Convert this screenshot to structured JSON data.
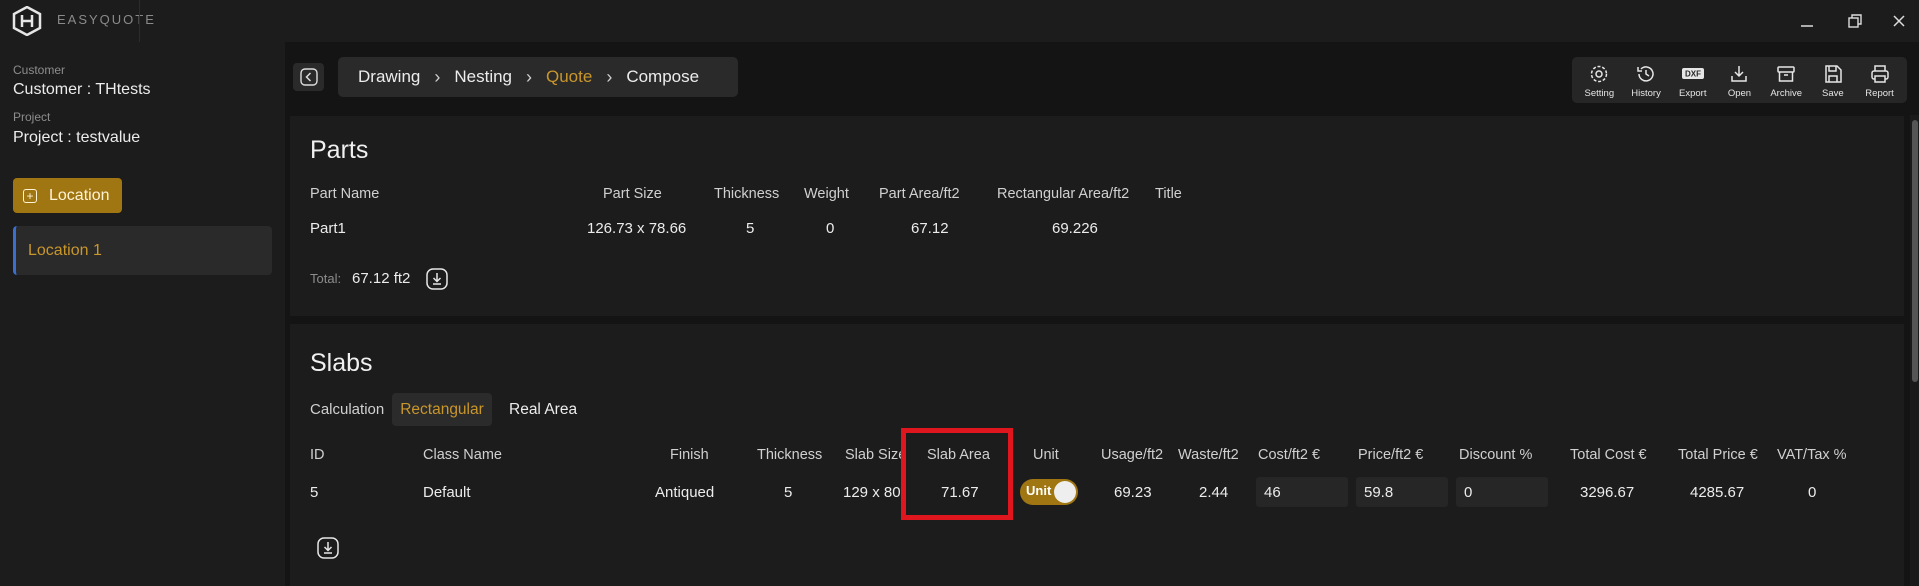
{
  "app": {
    "brand": "EASYQUOTE"
  },
  "sidebar": {
    "customer_label": "Customer",
    "customer_value": "Customer : THtests",
    "project_label": "Project",
    "project_value": "Project : testvalue",
    "location_button": "Location",
    "locations": [
      {
        "label": "Location 1"
      }
    ]
  },
  "breadcrumb": {
    "items": [
      {
        "label": "Drawing"
      },
      {
        "label": "Nesting"
      },
      {
        "label": "Quote"
      },
      {
        "label": "Compose"
      }
    ],
    "active": "Quote"
  },
  "toolbar": {
    "items": [
      {
        "label": "Setting",
        "icon": "gear-icon"
      },
      {
        "label": "History",
        "icon": "history-icon"
      },
      {
        "label": "Export",
        "icon": "dxf-export-icon"
      },
      {
        "label": "Open",
        "icon": "download-icon"
      },
      {
        "label": "Archive",
        "icon": "archive-icon"
      },
      {
        "label": "Save",
        "icon": "save-icon"
      },
      {
        "label": "Report",
        "icon": "printer-icon"
      }
    ]
  },
  "parts": {
    "title": "Parts",
    "headers": [
      "Part Name",
      "Part Size",
      "Thickness",
      "Weight",
      "Part Area/ft2",
      "Rectangular Area/ft2",
      "Title"
    ],
    "rows": [
      {
        "name": "Part1",
        "size": "126.73 x 78.66",
        "thickness": "5",
        "weight": "0",
        "part_area": "67.12",
        "rect_area": "69.226"
      }
    ],
    "total_label": "Total:",
    "total_value": "67.12 ft2"
  },
  "slabs": {
    "title": "Slabs",
    "calculation_label": "Calculation",
    "tabs": [
      "Rectangular",
      "Real Area"
    ],
    "active_tab": "Rectangular",
    "headers": [
      "ID",
      "Class Name",
      "Finish",
      "Thickness",
      "Slab Size",
      "Slab Area",
      "Unit",
      "Usage/ft2",
      "Waste/ft2",
      "Cost/ft2 €",
      "Price/ft2 €",
      "Discount %",
      "Total Cost €",
      "Total Price €",
      "VAT/Tax %"
    ],
    "rows": [
      {
        "id": "5",
        "class_name": "Default",
        "finish": "Antiqued",
        "thickness": "5",
        "slab_size": "129 x 80",
        "slab_area": "71.67",
        "unit_toggle": "Unit",
        "usage": "69.23",
        "waste": "2.44",
        "cost": "46",
        "price": "59.8",
        "discount": "0",
        "total_cost": "3296.67",
        "total_price": "4285.67",
        "vat": "0"
      }
    ]
  },
  "colors": {
    "accent": "#c9962a",
    "highlight": "#e0161e",
    "active_bar": "#3a6fd1"
  }
}
